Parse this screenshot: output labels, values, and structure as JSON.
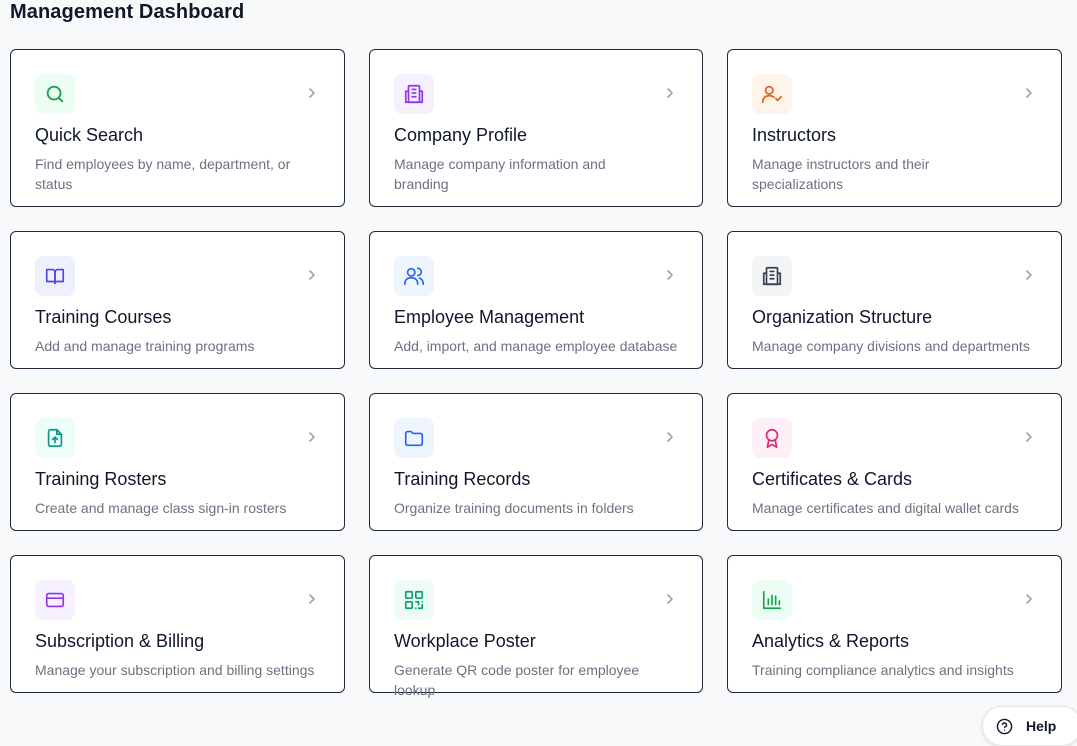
{
  "page": {
    "title": "Management Dashboard"
  },
  "cards": [
    {
      "title": "Quick Search",
      "description": "Find employees by name, department, or status",
      "icon": "search-icon",
      "icon_color": "#16a34a",
      "icon_bg": "#ecfdf3"
    },
    {
      "title": "Company Profile",
      "description": "Manage company information and branding",
      "icon": "building-icon",
      "icon_color": "#9333ea",
      "icon_bg": "#f5f0ff"
    },
    {
      "title": "Instructors",
      "description": "Manage instructors and their specializations",
      "icon": "user-check-icon",
      "icon_color": "#ea580c",
      "icon_bg": "#fff4ea"
    },
    {
      "title": "Training Courses",
      "description": "Add and manage training programs",
      "icon": "book-open-icon",
      "icon_color": "#4f46e5",
      "icon_bg": "#eef0fd"
    },
    {
      "title": "Employee Management",
      "description": "Add, import, and manage employee database",
      "icon": "users-icon",
      "icon_color": "#2563eb",
      "icon_bg": "#eff5ff"
    },
    {
      "title": "Organization Structure",
      "description": "Manage company divisions and departments",
      "icon": "building-icon",
      "icon_color": "#374151",
      "icon_bg": "#f3f4f6"
    },
    {
      "title": "Training Rosters",
      "description": "Create and manage class sign-in rosters",
      "icon": "file-upload-icon",
      "icon_color": "#0d9488",
      "icon_bg": "#ecfdfa"
    },
    {
      "title": "Training Records",
      "description": "Organize training documents in folders",
      "icon": "folder-icon",
      "icon_color": "#2563eb",
      "icon_bg": "#eff5ff"
    },
    {
      "title": "Certificates & Cards",
      "description": "Manage certificates and digital wallet cards",
      "icon": "award-icon",
      "icon_color": "#db2777",
      "icon_bg": "#fdf0f6"
    },
    {
      "title": "Subscription & Billing",
      "description": "Manage your subscription and billing settings",
      "icon": "credit-card-icon",
      "icon_color": "#9333ea",
      "icon_bg": "#f7f0ff"
    },
    {
      "title": "Workplace Poster",
      "description": "Generate QR code poster for employee lookup",
      "icon": "qr-code-icon",
      "icon_color": "#0f9f6e",
      "icon_bg": "#edfbf5"
    },
    {
      "title": "Analytics & Reports",
      "description": "Training compliance analytics and insights",
      "icon": "bar-chart-icon",
      "icon_color": "#16a34a",
      "icon_bg": "#ecfdf3"
    }
  ],
  "help": {
    "label": "Help",
    "icon": "help-circle-icon"
  }
}
